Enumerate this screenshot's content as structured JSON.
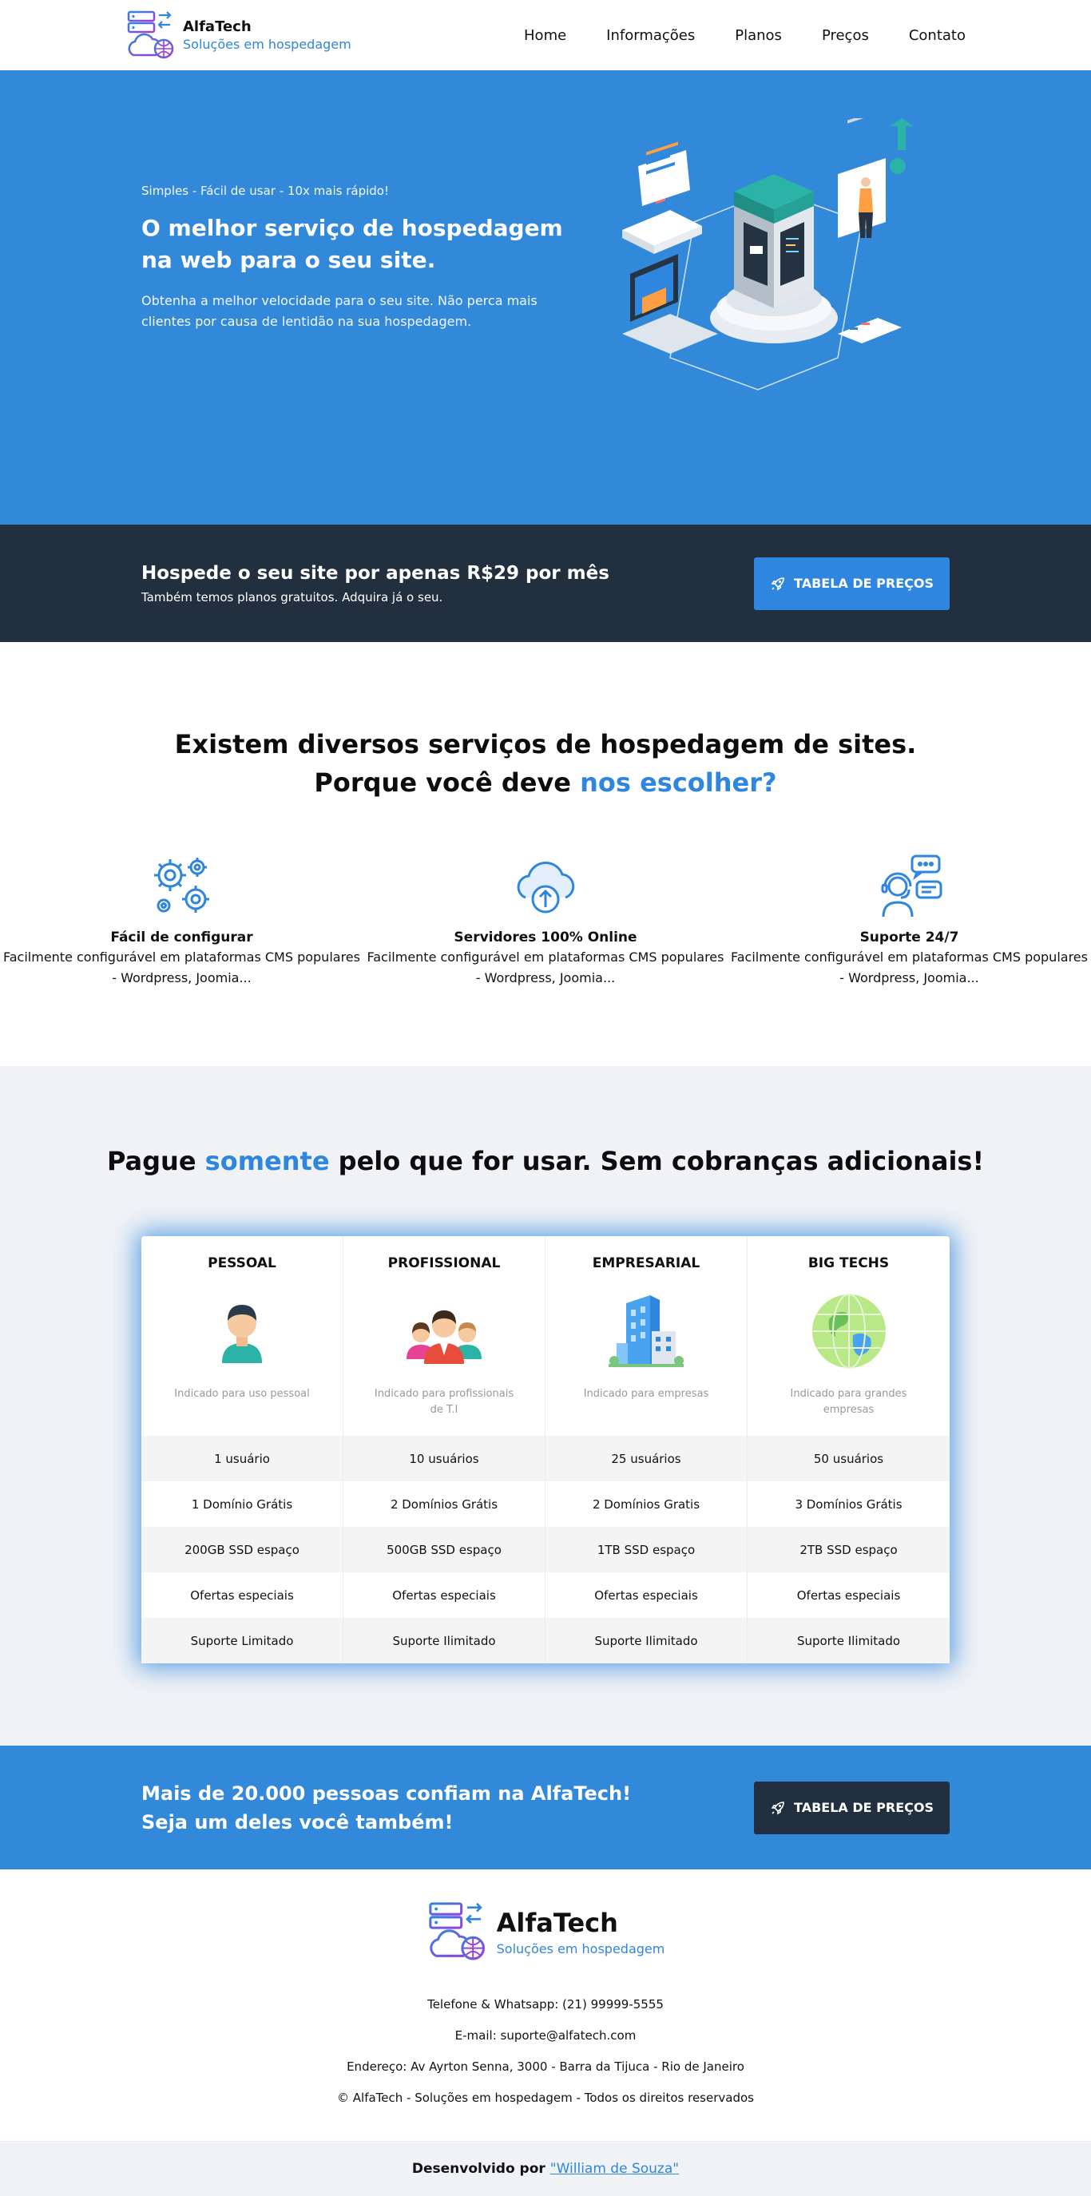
{
  "brand": {
    "name": "AlfaTech",
    "tagline": "Soluções em hospedagem",
    "accent": "#2e86de",
    "dark": "#222f3e",
    "blue": "#3288d9"
  },
  "nav": {
    "items": [
      "Home",
      "Informações",
      "Planos",
      "Preços",
      "Contato"
    ]
  },
  "hero": {
    "tagline": "Simples - Fácil de usar - 10x mais rápido!",
    "title": "O melhor serviço de hospedagem na web para o seu site.",
    "description": "Obtenha a melhor velocidade para o seu site. Não perca mais clientes por causa de lentidão na sua hospedagem.",
    "illustration": "isometric-server-illustration"
  },
  "cta_top": {
    "title": "Hospede o seu site por apenas R$29 por mês",
    "subtitle": "Também temos planos gratuitos. Adquira já o seu.",
    "button": "TABELA DE PREÇOS",
    "button_icon": "rocket-icon"
  },
  "why": {
    "heading_line1": "Existem diversos serviços de hospedagem de sites.",
    "heading_line2_prefix": "Porque você deve",
    "heading_line2_accent": "nos escolher?",
    "features": [
      {
        "icon": "gears-icon",
        "title": "Fácil de configurar",
        "desc_line1": "Facilmente configurável em plataformas CMS populares",
        "desc_line2": "- Wordpress, Joomia..."
      },
      {
        "icon": "cloud-upload-icon",
        "title": "Servidores 100% Online",
        "desc_line1": "Facilmente configurável em plataformas CMS populares",
        "desc_line2": "- Wordpress, Joomia..."
      },
      {
        "icon": "support-agent-icon",
        "title": "Suporte 24/7",
        "desc_line1": "Facilmente configurável em plataformas CMS populares",
        "desc_line2": "- Wordpress, Joomia..."
      }
    ]
  },
  "pricing": {
    "heading_prefix": "Pague",
    "heading_accent": "somente",
    "heading_suffix": "pelo que for usar. Sem cobranças adicionais!",
    "plans": [
      {
        "name": "PESSOAL",
        "icon": "person-icon",
        "desc": "Indicado para uso pessoal"
      },
      {
        "name": "PROFISSIONAL",
        "icon": "team-icon",
        "desc": "Indicado para profissionais de T.I"
      },
      {
        "name": "EMPRESARIAL",
        "icon": "building-icon",
        "desc": "Indicado para empresas"
      },
      {
        "name": "BIG TECHS",
        "icon": "globe-icon",
        "desc": "Indicado para grandes empresas"
      }
    ],
    "rows": [
      [
        "1 usuário",
        "10 usuários",
        "25 usuários",
        "50 usuários"
      ],
      [
        "1 Domínio Grátis",
        "2 Domínios Grátis",
        "2 Domínios Gratis",
        "3 Domínios Grátis"
      ],
      [
        "200GB SSD espaço",
        "500GB SSD espaço",
        "1TB SSD espaço",
        "2TB SSD espaço"
      ],
      [
        "Ofertas especiais",
        "Ofertas especiais",
        "Ofertas especiais",
        "Ofertas especiais"
      ],
      [
        "Suporte Limitado",
        "Suporte Ilimitado",
        "Suporte Ilimitado",
        "Suporte Ilimitado"
      ]
    ]
  },
  "cta_bottom": {
    "line1": "Mais de 20.000 pessoas confiam na AlfaTech!",
    "line2": "Seja um deles você também!",
    "button": "TABELA DE PREÇOS",
    "button_icon": "rocket-icon"
  },
  "footer": {
    "phone": "Telefone & Whatsapp: (21) 99999-5555",
    "email": "E-mail: suporte@alfatech.com",
    "address": "Endereço: Av Ayrton Senna, 3000 - Barra da Tijuca - Rio de Janeiro",
    "copyright": "© AlfaTech - Soluções em hospedagem - Todos os direitos reservados"
  },
  "developer": {
    "label": "Desenvolvido por",
    "author": "\"William de Souza\""
  }
}
